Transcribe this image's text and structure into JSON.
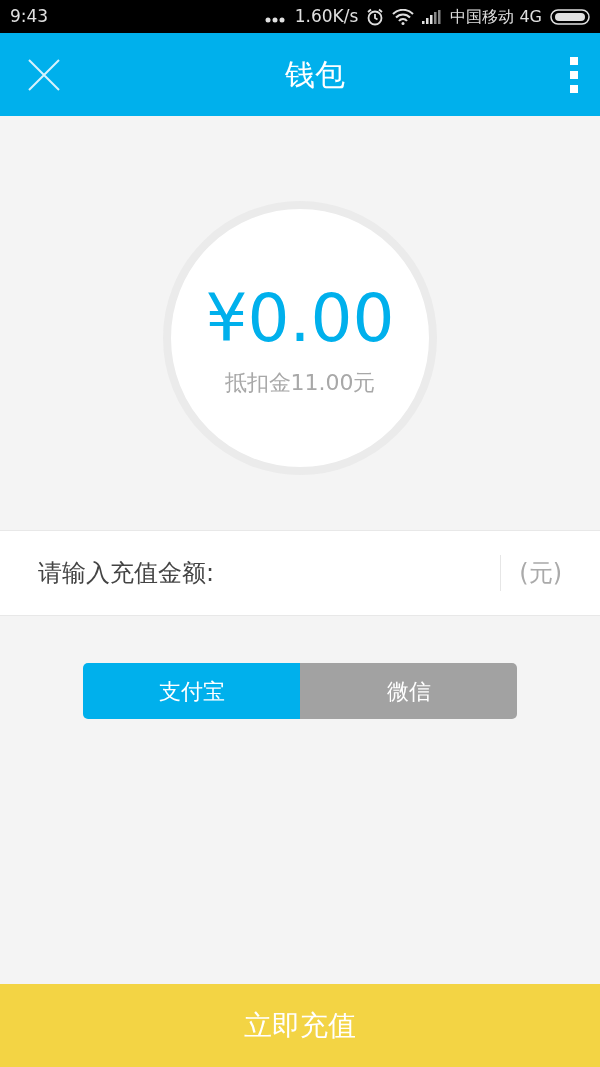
{
  "status_bar": {
    "time": "9:43",
    "speed": "1.60K/s",
    "carrier": "中国移动 4G"
  },
  "header": {
    "title": "钱包"
  },
  "balance": {
    "amount": "¥0.00",
    "deduction": "抵扣金11.00元"
  },
  "amount_field": {
    "label": "请输入充值金额:",
    "unit": "(元)"
  },
  "payment_tabs": [
    {
      "label": "支付宝",
      "selected": true
    },
    {
      "label": "微信",
      "selected": false
    }
  ],
  "submit_button": "立即充值"
}
